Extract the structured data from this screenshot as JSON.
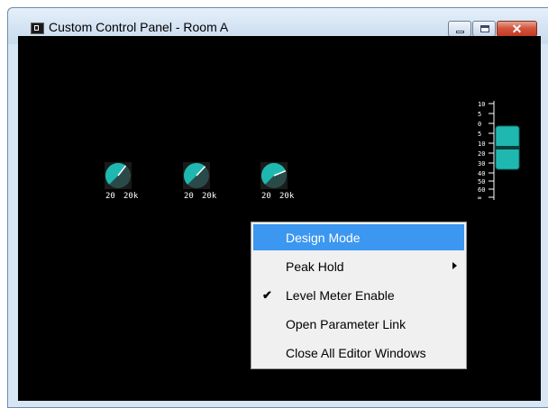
{
  "window": {
    "title": "Custom Control Panel - Room A"
  },
  "knobs": [
    {
      "min_label": "20",
      "max_label": "20k",
      "value_fraction": 0.64
    },
    {
      "min_label": "20",
      "max_label": "20k",
      "value_fraction": 0.66
    },
    {
      "min_label": "20",
      "max_label": "20k",
      "value_fraction": 0.75
    }
  ],
  "fader": {
    "scale_labels": [
      "10",
      "5",
      "0",
      "5",
      "10",
      "20",
      "30",
      "40",
      "50",
      "60",
      "∞"
    ],
    "color": "#1fb8b0"
  },
  "context_menu": {
    "items": [
      {
        "label": "Design Mode",
        "highlighted": true
      },
      {
        "label": "Peak Hold",
        "submenu": true
      },
      {
        "label": "Level Meter Enable",
        "checked": true
      },
      {
        "label": "Open Parameter Link"
      },
      {
        "label": "Close All Editor Windows"
      }
    ]
  },
  "colors": {
    "knob_fill": "#1fb8b0",
    "knob_track": "#2a4a4a",
    "menu_highlight": "#3c97f0",
    "canvas_bg": "#000000"
  }
}
